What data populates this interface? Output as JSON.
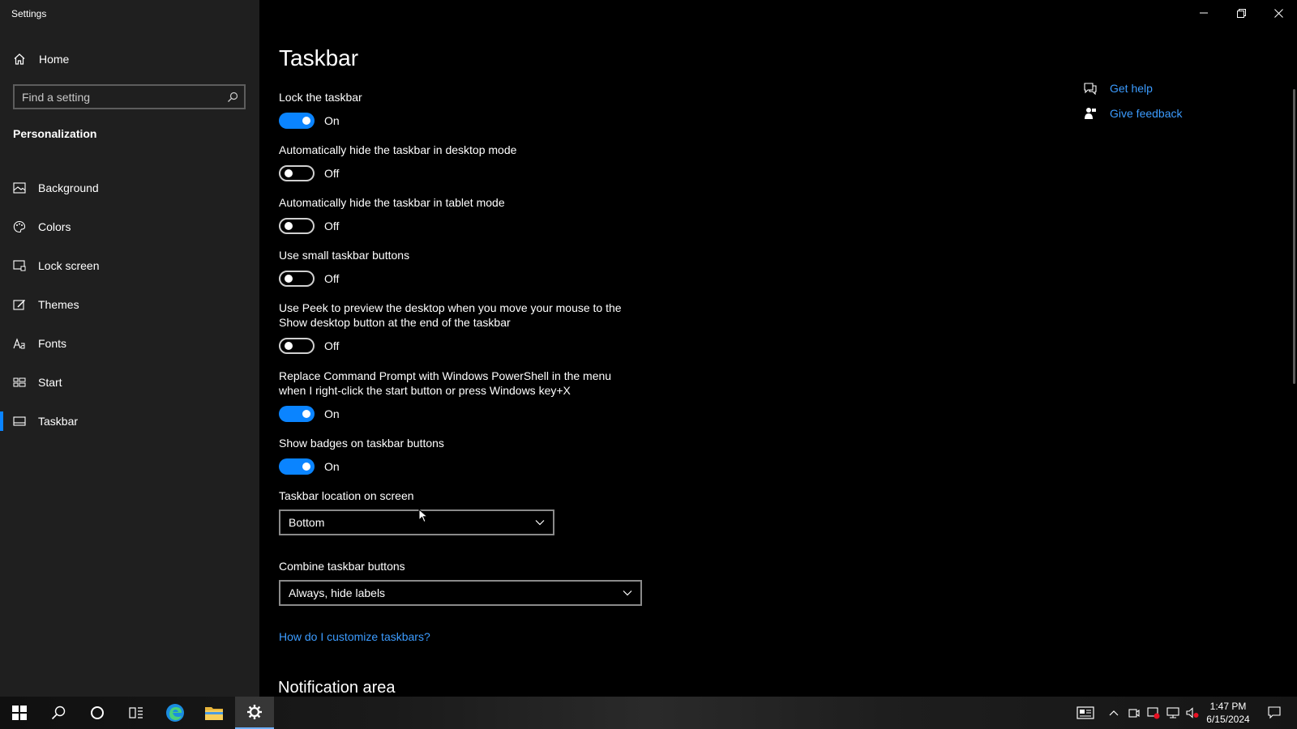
{
  "app": {
    "title": "Settings"
  },
  "sidebar": {
    "home_label": "Home",
    "search_placeholder": "Find a setting",
    "section_title": "Personalization",
    "items": [
      {
        "label": "Background",
        "icon": "picture-icon"
      },
      {
        "label": "Colors",
        "icon": "palette-icon"
      },
      {
        "label": "Lock screen",
        "icon": "lock-screen-icon"
      },
      {
        "label": "Themes",
        "icon": "themes-icon"
      },
      {
        "label": "Fonts",
        "icon": "fonts-icon"
      },
      {
        "label": "Start",
        "icon": "start-icon"
      },
      {
        "label": "Taskbar",
        "icon": "taskbar-icon",
        "active": true
      }
    ]
  },
  "main": {
    "title": "Taskbar",
    "settings": [
      {
        "label": "Lock the taskbar",
        "state": "On"
      },
      {
        "label": "Automatically hide the taskbar in desktop mode",
        "state": "Off"
      },
      {
        "label": "Automatically hide the taskbar in tablet mode",
        "state": "Off"
      },
      {
        "label": "Use small taskbar buttons",
        "state": "Off"
      },
      {
        "label": "Use Peek to preview the desktop when you move your mouse to the Show desktop button at the end of the taskbar",
        "state": "Off"
      },
      {
        "label": "Replace Command Prompt with Windows PowerShell in the menu when I right-click the start button or press Windows key+X",
        "state": "On"
      },
      {
        "label": "Show badges on taskbar buttons",
        "state": "On"
      }
    ],
    "location": {
      "label": "Taskbar location on screen",
      "value": "Bottom"
    },
    "combine": {
      "label": "Combine taskbar buttons",
      "value": "Always, hide labels"
    },
    "customize_link": "How do I customize taskbars?",
    "notification_heading": "Notification area"
  },
  "help": {
    "get_help": "Get help",
    "give_feedback": "Give feedback"
  },
  "taskbar": {
    "time": "1:47 PM",
    "date": "6/15/2024"
  },
  "colors": {
    "accent": "#0a84ff",
    "link": "#3c9cff",
    "sidebar_bg": "#1f1f1f"
  }
}
